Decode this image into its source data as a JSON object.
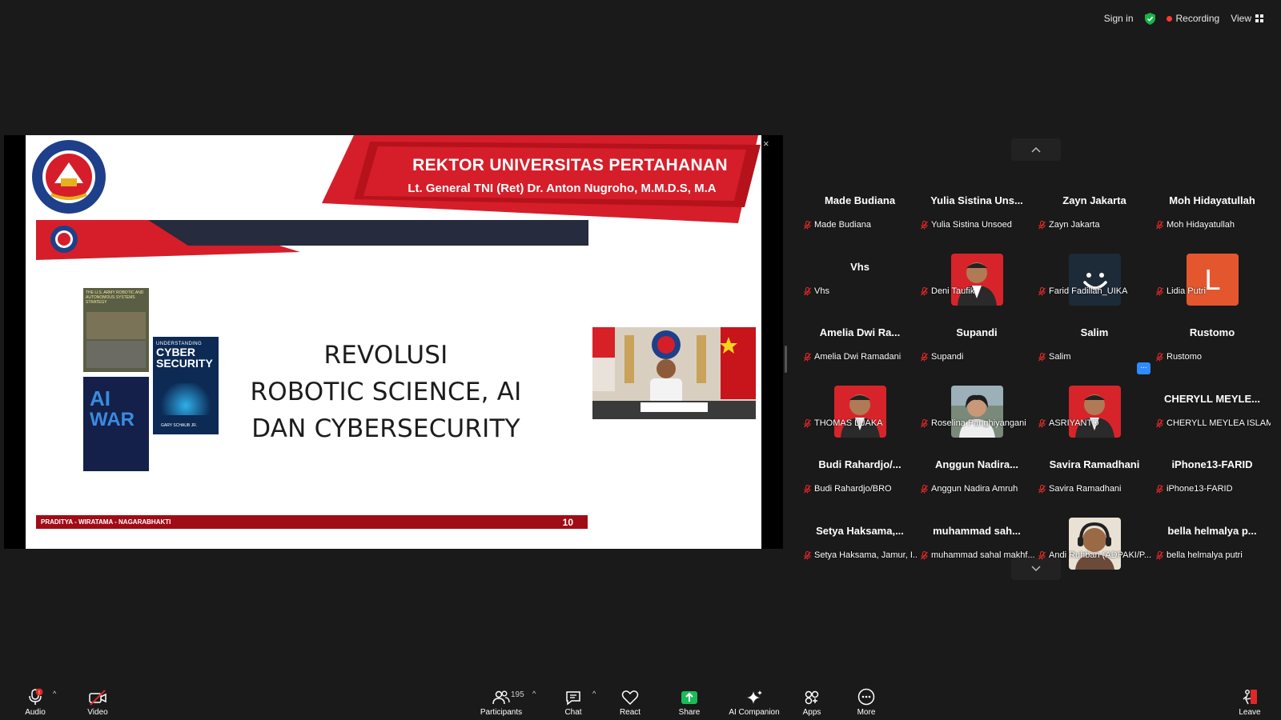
{
  "topbar": {
    "sign_in": "Sign in",
    "recording": "Recording",
    "view": "View",
    "colors": {
      "shield": "#1ab34a",
      "recording_dot": "#ff3b30"
    }
  },
  "slide": {
    "banner_title": "REKTOR UNIVERSITAS PERTAHANAN",
    "banner_subtitle": "Lt. General TNI (Ret) Dr. Anton Nugroho, M.M.D.S, M.A",
    "title_lines": [
      "REVOLUSI",
      "ROBOTIC SCIENCE, AI",
      "DAN CYBERSECURITY"
    ],
    "footer_text": "PRADITYA - WIRATAMA - NAGARABHAKTI",
    "page_number": "10",
    "logo_text": "UNIVERSITAS PERTAHANAN REPUBLIK INDONESIA",
    "books": {
      "book1": "THE U.S. ARMY ROBOTIC AND AUTONOMOUS SYSTEMS STRATEGY",
      "book2_line1": "UNDERSTANDING",
      "book2_line2": "CYBER",
      "book2_line3": "SECURITY",
      "book2_author": "GARY SCHAUB JR.",
      "book3_line1": "AI",
      "book3_line2": "WAR"
    },
    "colors": {
      "red": "#d51e2a",
      "dark_red": "#a00c16",
      "navy": "#262b3d"
    }
  },
  "participants": [
    {
      "big": "Made Budiana",
      "label": "Made Budiana"
    },
    {
      "big": "Yulia Sistina Uns...",
      "label": "Yulia Sistina Unsoed"
    },
    {
      "big": "Zayn Jakarta",
      "label": "Zayn Jakarta"
    },
    {
      "big": "Moh Hidayatullah",
      "label": "Moh Hidayatullah"
    },
    {
      "big": "Vhs",
      "label": "Vhs"
    },
    {
      "big": "",
      "label": "Deni Taufik"
    },
    {
      "big": "",
      "label": "Farid Fadillah_UIKA"
    },
    {
      "big": "",
      "label": "Lidia Putri",
      "avatar_letter": "L"
    },
    {
      "big": "Amelia Dwi Ra...",
      "label": "Amelia Dwi Ramadani"
    },
    {
      "big": "Supandi",
      "label": "Supandi"
    },
    {
      "big": "Salim",
      "label": "Salim"
    },
    {
      "big": "Rustomo",
      "label": "Rustomo"
    },
    {
      "big": "",
      "label": "THOMAS DJAKA"
    },
    {
      "big": "",
      "label": "Roselina Panghiyangani"
    },
    {
      "big": "",
      "label": "ASRIYANTO"
    },
    {
      "big": "CHERYLL MEYLE...",
      "label": "CHERYLL MEYLEA ISLAM..."
    },
    {
      "big": "Budi Rahardjo/...",
      "label": "Budi Rahardjo/BRO"
    },
    {
      "big": "Anggun Nadira...",
      "label": "Anggun Nadira Amruh"
    },
    {
      "big": "Savira Ramadhani",
      "label": "Savira Ramadhani"
    },
    {
      "big": "iPhone13-FARID",
      "label": "iPhone13-FARID"
    },
    {
      "big": "Setya Haksama,...",
      "label": "Setya Haksama, Jamur, I..."
    },
    {
      "big": "muhammad sah...",
      "label": "muhammad sahal makhf..."
    },
    {
      "big": "",
      "label": "Andi Ruhban (ADPAKI/P..."
    },
    {
      "big": "bella helmalya p...",
      "label": "bella helmalya putri"
    }
  ],
  "gallery_more": "...",
  "toolbar": {
    "audio": "Audio",
    "video": "Video",
    "participants": "Participants",
    "participants_count": "195",
    "chat": "Chat",
    "react": "React",
    "share": "Share",
    "ai_companion": "AI Companion",
    "apps": "Apps",
    "more": "More",
    "leave": "Leave",
    "colors": {
      "share_green": "#19bd57",
      "mute_red": "#e02828"
    }
  },
  "close_share": "×"
}
